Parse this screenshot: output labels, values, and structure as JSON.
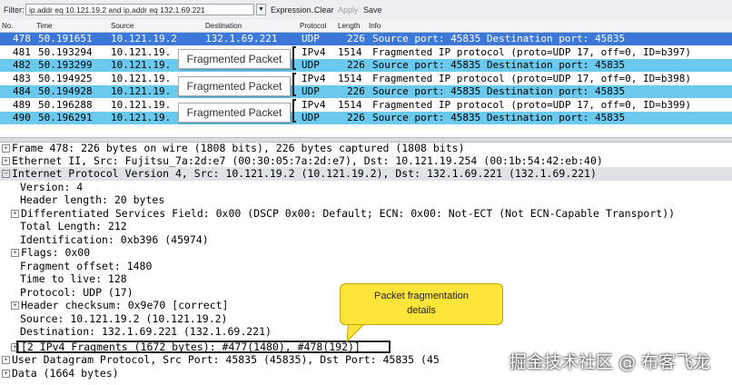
{
  "toolbar": {
    "filter_label": "Filter:",
    "filter_value": "ip.addr eq 10.121.19.2 and ip.addr eq 132.1.69.221",
    "dropdown_glyph": "▼",
    "expression": "Expression...",
    "clear": "Clear",
    "apply": "Apply",
    "save": "Save"
  },
  "columns": {
    "no": "No.",
    "time": "Time",
    "source": "Source",
    "destination": "Destination",
    "protocol": "Protocol",
    "length": "Length",
    "info": "Info"
  },
  "packets": [
    {
      "no": "478",
      "time": "50.191651",
      "source": "10.121.19.2",
      "destination": "132.1.69.221",
      "protocol": "UDP",
      "length": "226",
      "info": "Source port: 45835  Destination port: 45835"
    },
    {
      "no": "481",
      "time": "50.193294",
      "source": "10.121.19.",
      "destination": "",
      "protocol": "IPv4",
      "length": "1514",
      "info": "Fragmented IP protocol (proto=UDP 17, off=0, ID=b397)"
    },
    {
      "no": "482",
      "time": "50.193299",
      "source": "10.121.19.",
      "destination": "",
      "protocol": "UDP",
      "length": "226",
      "info": "Source port: 45835  Destination port: 45835"
    },
    {
      "no": "483",
      "time": "50.194925",
      "source": "10.121.19.",
      "destination": "",
      "protocol": "IPv4",
      "length": "1514",
      "info": "Fragmented IP protocol (proto=UDP 17, off=0, ID=b398)"
    },
    {
      "no": "484",
      "time": "50.194928",
      "source": "10.121.19.",
      "destination": "",
      "protocol": "UDP",
      "length": "226",
      "info": "Source port: 45835  Destination port: 45835"
    },
    {
      "no": "489",
      "time": "50.196288",
      "source": "10.121.19.",
      "destination": "",
      "protocol": "IPv4",
      "length": "1514",
      "info": "Fragmented IP protocol (proto=UDP 17, off=0, ID=b399)"
    },
    {
      "no": "490",
      "time": "50.196291",
      "source": "10.121.19.",
      "destination": "",
      "protocol": "UDP",
      "length": "226",
      "info": "Source port: 45835  Destination port: 45835"
    }
  ],
  "fragment_label": "Fragmented Packet",
  "details": [
    "Frame 478: 226 bytes on wire (1808 bits), 226 bytes captured (1808 bits)",
    "Ethernet II, Src: Fujitsu_7a:2d:e7 (00:30:05:7a:2d:e7), Dst: 10.121.19.254 (00:1b:54:42:eb:40)",
    "Internet Protocol Version 4, Src: 10.121.19.2 (10.121.19.2), Dst: 132.1.69.221 (132.1.69.221)",
    "Version: 4",
    "Header length: 20 bytes",
    "Differentiated Services Field: 0x00 (DSCP 0x00: Default; ECN: 0x00: Not-ECT (Not ECN-Capable Transport))",
    "Total Length: 212",
    "Identification: 0xb396 (45974)",
    "Flags: 0x00",
    "Fragment offset: 1480",
    "Time to live: 128",
    "Protocol: UDP (17)",
    "Header checksum: 0x9e70 [correct]",
    "Source: 10.121.19.2 (10.121.19.2)",
    "Destination: 132.1.69.221 (132.1.69.221)",
    "[2 IPv4 Fragments (1672 bytes): #477(1480), #478(192)]",
    "User Datagram Protocol, Src Port: 45835 (45835), Dst Port: 45835 (45",
    "Data (1664 bytes)"
  ],
  "callout": {
    "line1": "Packet fragmentation",
    "line2": "details"
  },
  "watermark": "掘金技术社区 @ 布客飞龙",
  "colors": {
    "udp_row": "#6cc9ee",
    "selected_row": "#3c78d8",
    "callout": "#ffe43a"
  }
}
